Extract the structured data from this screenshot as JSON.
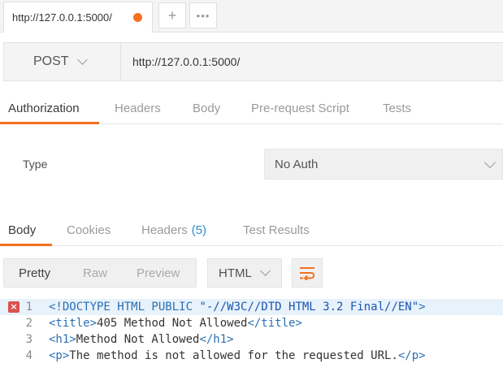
{
  "tabstrip": {
    "active_tab_title": "http://127.0.0.1:5000/",
    "add_label": "+",
    "more_label": "•••"
  },
  "request": {
    "method": "POST",
    "url": "http://127.0.0.1:5000/"
  },
  "request_tabs": [
    {
      "label": "Authorization",
      "active": true
    },
    {
      "label": "Headers",
      "active": false
    },
    {
      "label": "Body",
      "active": false
    },
    {
      "label": "Pre-request Script",
      "active": false
    },
    {
      "label": "Tests",
      "active": false
    }
  ],
  "auth": {
    "type_label": "Type",
    "selected": "No Auth"
  },
  "response_tabs": {
    "body": "Body",
    "cookies": "Cookies",
    "headers": "Headers",
    "headers_count": "(5)",
    "test_results": "Test Results"
  },
  "view_options": [
    "Pretty",
    "Raw",
    "Preview"
  ],
  "format": "HTML",
  "code_lines": [
    {
      "num": "1",
      "parts": [
        [
          "tag",
          "<!DOCTYPE HTML PUBLIC "
        ],
        [
          "str",
          "\"-//W3C//DTD HTML 3.2 Final//EN\""
        ],
        [
          "tag",
          ">"
        ]
      ],
      "error": true
    },
    {
      "num": "2",
      "parts": [
        [
          "tag",
          "<title>"
        ],
        [
          "txt",
          "405 Method Not Allowed"
        ],
        [
          "tag",
          "</title>"
        ]
      ],
      "error": false
    },
    {
      "num": "3",
      "parts": [
        [
          "tag",
          "<h1>"
        ],
        [
          "txt",
          "Method Not Allowed"
        ],
        [
          "tag",
          "</h1>"
        ]
      ],
      "error": false
    },
    {
      "num": "4",
      "parts": [
        [
          "tag",
          "<p>"
        ],
        [
          "txt",
          "The method is not allowed for the requested URL."
        ],
        [
          "tag",
          "</p>"
        ]
      ],
      "error": false
    }
  ],
  "colors": {
    "accent": "#f47023",
    "link_blue": "#2e8cd0",
    "error_red": "#d9534f"
  }
}
